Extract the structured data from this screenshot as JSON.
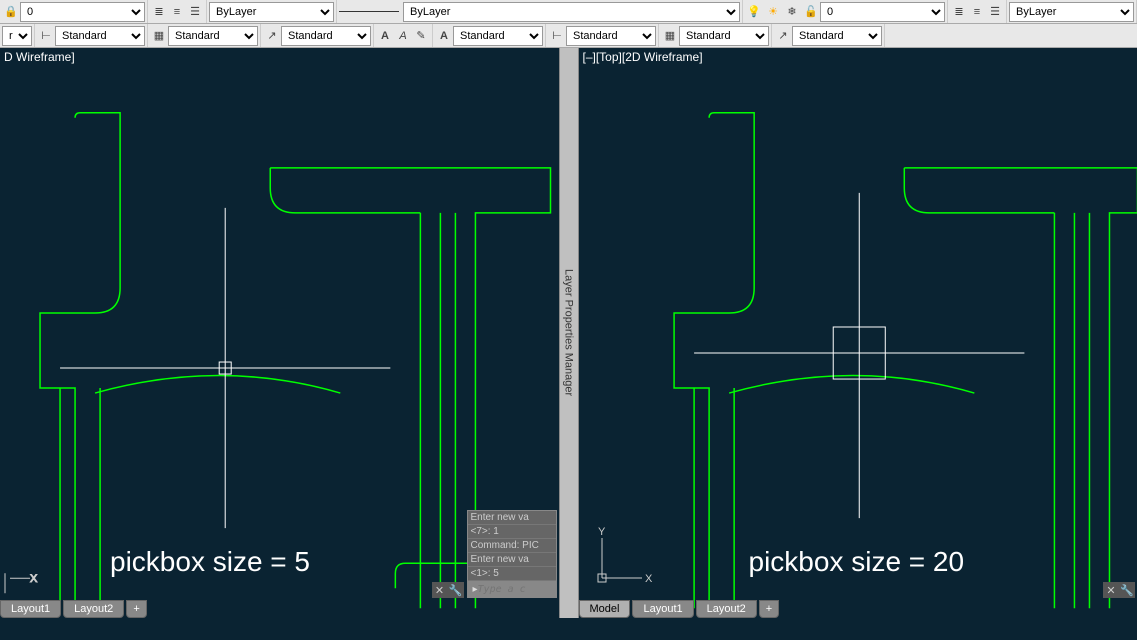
{
  "toolbar": {
    "layer_combo_left": "0",
    "bylayer_combo": "ByLayer",
    "linetype_label": "ByLayer",
    "layer_combo_right": "0",
    "bylayer_combo_right": "ByLayer"
  },
  "toolbar2": {
    "style_label_trunc": "rd",
    "standard": "Standard"
  },
  "viewports": {
    "left_label": "D Wireframe]",
    "right_label": "[–][Top][2D Wireframe]"
  },
  "divider_label": "Layer Properties Manager",
  "annotations": {
    "left_text": "pickbox size = 5",
    "right_text": "pickbox size = 20"
  },
  "cmdbox": {
    "line1": "Enter new va",
    "line2": "<7>: 1",
    "line3": "Command: PIC",
    "line4": "Enter new va",
    "line5": "<1>: 5",
    "placeholder": "Type a c"
  },
  "tabs": {
    "model": "Model",
    "layout1": "Layout1",
    "layout2": "Layout2",
    "plus": "+"
  },
  "ucs": {
    "x": "X",
    "y": "Y"
  }
}
